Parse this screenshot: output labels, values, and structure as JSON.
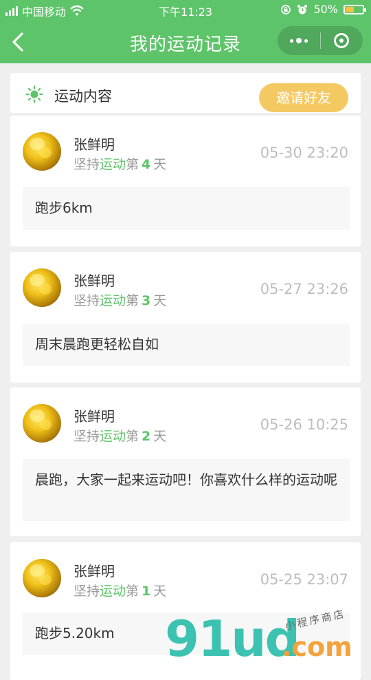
{
  "status_bar": {
    "carrier": "中国移动",
    "time": "下午11:23",
    "battery": "50%",
    "battery_level": 0.5
  },
  "nav": {
    "title": "我的运动记录"
  },
  "header": {
    "label": "运动内容",
    "invite_button": "邀请好友"
  },
  "streak_text": {
    "prefix": "坚持",
    "highlight": "运动",
    "mid": "第",
    "suffix": "天"
  },
  "records": [
    {
      "name": "张鲜明",
      "days": "4",
      "time": "05-30 23:20",
      "content": "跑步6km"
    },
    {
      "name": "张鲜明",
      "days": "3",
      "time": "05-27 23:26",
      "content": "周末晨跑更轻松自如"
    },
    {
      "name": "张鲜明",
      "days": "2",
      "time": "05-26 10:25",
      "content": "晨跑，大家一起来运动吧！你喜欢什么样的运动呢"
    },
    {
      "name": "张鲜明",
      "days": "1",
      "time": "05-25 23:07",
      "content": "跑步5.20km"
    }
  ],
  "watermark": {
    "brand": "91ud",
    "domain": ".com",
    "tagline": "小程序商店"
  },
  "colors": {
    "primary_green": "#5ec46a",
    "invite_yellow": "#f5c962",
    "time_gray": "#bdbdbd"
  }
}
